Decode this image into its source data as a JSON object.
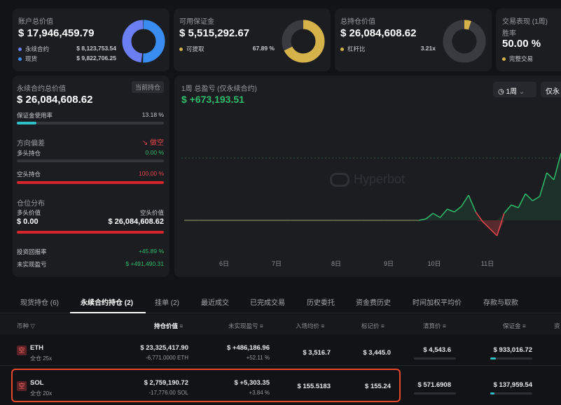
{
  "summary": {
    "account": {
      "label": "账户总价值",
      "value": "$ 17,946,459.79",
      "items": [
        {
          "label": "永续合约",
          "value": "$ 8,123,753.54",
          "color": "#6b7ff2"
        },
        {
          "label": "现货",
          "value": "$ 9,822,706.25",
          "color": "#3a8df0"
        }
      ]
    },
    "margin": {
      "label": "可用保证金",
      "value": "$ 5,515,292.67",
      "item_label": "可提取",
      "item_value": "67.89 %",
      "color": "#d6b24a"
    },
    "position": {
      "label": "总持仓价值",
      "value": "$ 26,084,608.62",
      "item_label": "杠杆比",
      "item_value": "3.21x",
      "color": "#d6b24a"
    },
    "trading": {
      "label": "交易表现 (1周)",
      "winrate_label": "胜率",
      "winrate": "50.00 %",
      "item_label": "完整交易",
      "color": "#d6b24a"
    }
  },
  "perp": {
    "label": "永续合约总价值",
    "badge": "当前持仓",
    "value": "$ 26,084,608.62",
    "margin_usage_label": "保证金使用率",
    "margin_usage": "13.18 %",
    "margin_usage_frac": 0.1318,
    "direction_label": "方向偏差",
    "direction_value": "做空",
    "long_label": "多头持仓",
    "long_pct": "0.00 %",
    "short_label": "空头持仓",
    "short_pct": "100.00 %",
    "dist_label": "仓位分布",
    "long_value_label": "多头价值",
    "short_value_label": "空头价值",
    "long_value": "$ 0.00",
    "short_value": "$ 26,084,608.62",
    "roi_label": "投资回报率",
    "roi": "+45.89 %",
    "upnl_label": "未实现盈亏",
    "upnl": "$ +491,490.31"
  },
  "pnl_chart": {
    "title": "1周 总盈亏 (仅永续合约)",
    "value": "$ +673,193.51",
    "period": "1周",
    "toggle": "仅永",
    "watermark": "Hyperbot"
  },
  "chart_data": {
    "type": "line",
    "x": [
      "6日",
      "7日",
      "8日",
      "9日",
      "10日",
      "11日"
    ],
    "series": [
      {
        "values_by_step": [
          0,
          0,
          0,
          0,
          0,
          0,
          0,
          0,
          0,
          0,
          0,
          0,
          0,
          0,
          0,
          0,
          0,
          0,
          0,
          0,
          0,
          0,
          0,
          0,
          0,
          0,
          0,
          0,
          0,
          0,
          0,
          0,
          0,
          0,
          0.05,
          0.25,
          0.1,
          0.4,
          0.3,
          0.5,
          0.9,
          0.3,
          -0.05,
          -0.3,
          -0.55,
          0.25,
          0.55,
          0.45,
          0.95,
          0.7,
          0.85,
          1.7,
          1.45,
          2.4
        ]
      }
    ]
  },
  "tabs": [
    "现货持仓 (6)",
    "永续合约持仓 (2)",
    "挂单 (2)",
    "最近成交",
    "已完成交易",
    "历史委托",
    "资金费历史",
    "时间加权平均价",
    "存款与取款"
  ],
  "table": {
    "headers": [
      "币种",
      "持仓价值",
      "未实现盈亏",
      "入场均价",
      "标记价",
      "清算价",
      "保证金",
      "资"
    ],
    "rows": [
      {
        "icon": "空",
        "coin": "ETH",
        "mode": "全仓 25x",
        "value": "$ 23,325,417.90",
        "size": "-6,771.0000 ETH",
        "pnl": "$ +486,186.96",
        "pnl_pct": "+52.11 %",
        "entry": "$ 3,516.7",
        "mark": "$ 3,445.0",
        "liq": "$ 4,543.6",
        "margin": "$ 933,016.72"
      },
      {
        "icon": "空",
        "coin": "SOL",
        "mode": "全仓 20x",
        "value": "$ 2,759,190.72",
        "size": "-17,776.00 SOL",
        "pnl": "$ +5,303.35",
        "pnl_pct": "+3.84 %",
        "entry": "$ 155.5183",
        "mark": "$ 155.24",
        "liq": "$ 571.6908",
        "margin": "$ 137,959.54"
      }
    ]
  }
}
